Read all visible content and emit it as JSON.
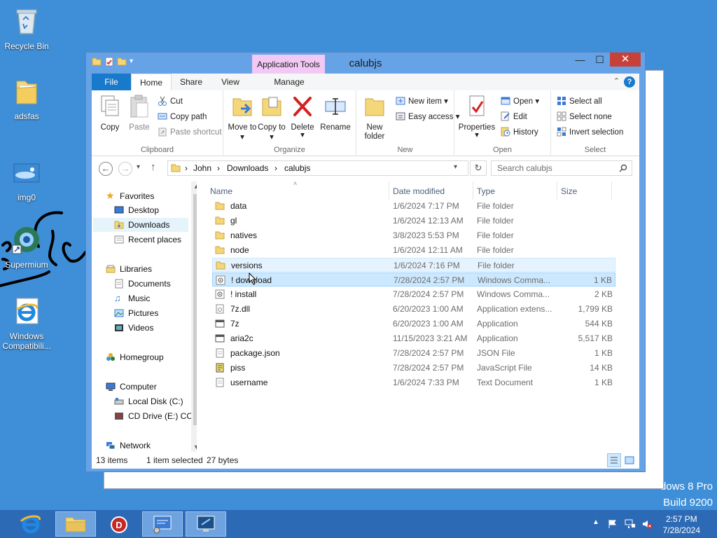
{
  "desktop": {
    "icons": [
      {
        "label": "Recycle Bin"
      },
      {
        "label": "adsfas"
      },
      {
        "label": "img0"
      },
      {
        "label": "Supermium"
      },
      {
        "label": "Windows Compatibili..."
      }
    ],
    "watermark_line1": "dows 8 Pro",
    "watermark_line2": "Build 9200"
  },
  "window": {
    "title": "calubjs",
    "context_tab": "Application Tools",
    "tabs": [
      "File",
      "Home",
      "Share",
      "View",
      "Manage"
    ],
    "controls": {
      "minimize": "—",
      "maximize": "☐",
      "close": "✕"
    }
  },
  "ribbon": {
    "clipboard": {
      "label": "Clipboard",
      "copy": "Copy",
      "paste": "Paste",
      "cut": "Cut",
      "copy_path": "Copy path",
      "paste_shortcut": "Paste shortcut"
    },
    "organize": {
      "label": "Organize",
      "move_to": "Move to ▾",
      "copy_to": "Copy to ▾",
      "delete": "Delete",
      "delete_arrow": "▾",
      "rename": "Rename"
    },
    "new": {
      "label": "New",
      "new_folder": "New folder",
      "new_item": "New item ▾",
      "easy_access": "Easy access ▾"
    },
    "open": {
      "label": "Open",
      "properties": "Properties",
      "properties_arrow": "▾",
      "open": "Open ▾",
      "edit": "Edit",
      "history": "History"
    },
    "select": {
      "label": "Select",
      "select_all": "Select all",
      "select_none": "Select none",
      "invert": "Invert selection"
    }
  },
  "address": {
    "crumbs": [
      "John",
      "Downloads",
      "calubjs"
    ],
    "search_placeholder": "Search calubjs"
  },
  "nav": {
    "favorites": "Favorites",
    "desktop": "Desktop",
    "downloads": "Downloads",
    "recent": "Recent places",
    "libraries": "Libraries",
    "documents": "Documents",
    "music": "Music",
    "pictures": "Pictures",
    "videos": "Videos",
    "homegroup": "Homegroup",
    "computer": "Computer",
    "local_disk": "Local Disk (C:)",
    "cd_drive": "CD Drive (E:) CCC",
    "network": "Network"
  },
  "columns": {
    "name": "Name",
    "date": "Date modified",
    "type": "Type",
    "size": "Size"
  },
  "files": [
    {
      "name": "data",
      "date": "1/6/2024 7:17 PM",
      "type": "File folder",
      "size": "",
      "icon": "folder-icon"
    },
    {
      "name": "gl",
      "date": "1/6/2024 12:13 AM",
      "type": "File folder",
      "size": "",
      "icon": "folder-icon"
    },
    {
      "name": "natives",
      "date": "3/8/2023 5:53 PM",
      "type": "File folder",
      "size": "",
      "icon": "folder-icon"
    },
    {
      "name": "node",
      "date": "1/6/2024 12:11 AM",
      "type": "File folder",
      "size": "",
      "icon": "folder-icon"
    },
    {
      "name": "versions",
      "date": "1/6/2024 7:16 PM",
      "type": "File folder",
      "size": "",
      "icon": "folder-icon"
    },
    {
      "name": "! download",
      "date": "7/28/2024 2:57 PM",
      "type": "Windows Comma...",
      "size": "1 KB",
      "icon": "batch-file-icon"
    },
    {
      "name": "! install",
      "date": "7/28/2024 2:57 PM",
      "type": "Windows Comma...",
      "size": "2 KB",
      "icon": "batch-file-icon"
    },
    {
      "name": "7z.dll",
      "date": "6/20/2023 1:00 AM",
      "type": "Application extens...",
      "size": "1,799 KB",
      "icon": "dll-file-icon"
    },
    {
      "name": "7z",
      "date": "6/20/2023 1:00 AM",
      "type": "Application",
      "size": "544 KB",
      "icon": "exe-file-icon"
    },
    {
      "name": "aria2c",
      "date": "11/15/2023 3:21 AM",
      "type": "Application",
      "size": "5,517 KB",
      "icon": "exe-file-icon"
    },
    {
      "name": "package.json",
      "date": "7/28/2024 2:57 PM",
      "type": "JSON File",
      "size": "1 KB",
      "icon": "json-file-icon"
    },
    {
      "name": "piss",
      "date": "7/28/2024 2:57 PM",
      "type": "JavaScript File",
      "size": "14 KB",
      "icon": "js-file-icon"
    },
    {
      "name": "username",
      "date": "1/6/2024 7:33 PM",
      "type": "Text Document",
      "size": "1 KB",
      "icon": "text-file-icon"
    }
  ],
  "status": {
    "items": "13 items",
    "selected": "1 item selected",
    "size": "27 bytes"
  },
  "taskbar": {
    "time": "2:57 PM",
    "date": "7/28/2024"
  }
}
